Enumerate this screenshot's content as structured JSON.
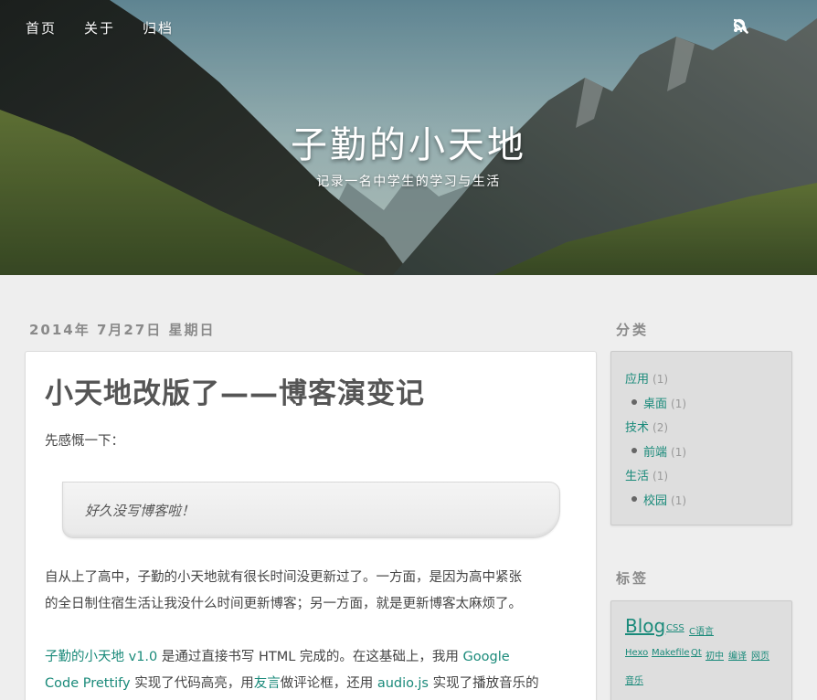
{
  "nav": {
    "items": [
      {
        "label": "首页"
      },
      {
        "label": "关于"
      },
      {
        "label": "归档"
      }
    ],
    "icons": [
      "rss-icon",
      "search-icon"
    ]
  },
  "site": {
    "title": "子勤的小天地",
    "subtitle": "记录一名中学生的学习与生活"
  },
  "post": {
    "date": "2014年 7月27日 星期日",
    "title": "小天地改版了——博客演变记",
    "intro": "先感慨一下：",
    "quote": "好久没写博客啦！",
    "para1_line1": "自从上了高中，子勤的小天地就有很长时间没更新过了。一方面，是因为高中紧张",
    "para1_line2": "的全日制住宿生活让我没什么时间更新博客；另一方面，就是更新博客太麻烦了。",
    "para2": {
      "link1": "子勤的小天地 v1.0",
      "text1": " 是通过直接书写 HTML 完成的。在这基础上，我用 ",
      "link2": "Google",
      "link2b": "Code Prettify",
      "text2": " 实现了代码高亮，用",
      "link3": "友言",
      "text3": "做评论框，还用 ",
      "link4": "audio.js",
      "text4": " 实现了播放音乐的"
    }
  },
  "sidebar": {
    "categories_heading": "分类",
    "categories": [
      {
        "label": "应用",
        "count": "(1)",
        "level": 0
      },
      {
        "label": "桌面",
        "count": "(1)",
        "level": 1
      },
      {
        "label": "技术",
        "count": "(2)",
        "level": 0
      },
      {
        "label": "前端",
        "count": "(1)",
        "level": 1
      },
      {
        "label": "生活",
        "count": "(1)",
        "level": 0
      },
      {
        "label": "校园",
        "count": "(1)",
        "level": 1
      }
    ],
    "tags_heading": "标签",
    "tags": [
      {
        "label": "Blog"
      },
      {
        "label": "CSS"
      },
      {
        "label": "C语言"
      },
      {
        "label": "Hexo"
      },
      {
        "label": "Makefile"
      },
      {
        "label": "Qt"
      },
      {
        "label": "初中"
      },
      {
        "label": "编译"
      },
      {
        "label": "网页"
      },
      {
        "label": "音乐"
      }
    ]
  },
  "colors": {
    "accent": "#1a8a7a",
    "background": "#eeeeee",
    "sidebar_box": "#dedede"
  }
}
